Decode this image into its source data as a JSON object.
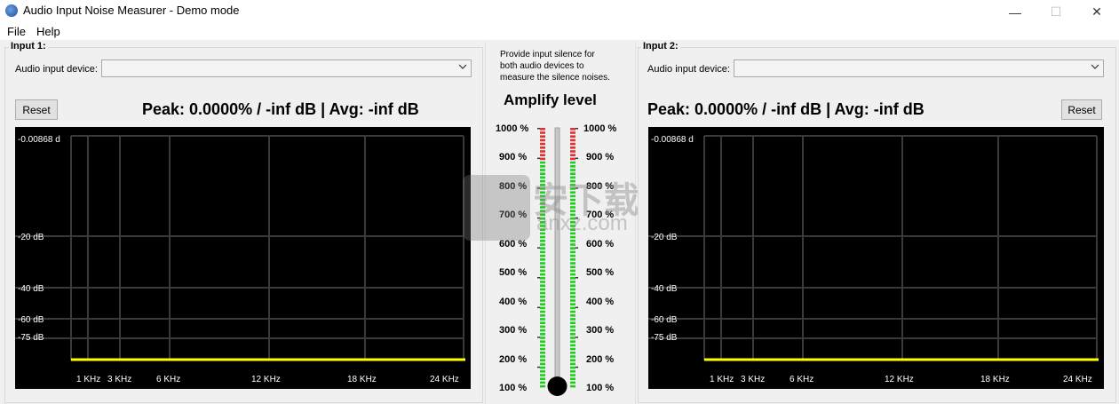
{
  "window": {
    "title": "Audio Input Noise Measurer - Demo mode",
    "min_glyph": "—",
    "max_glyph": "☐",
    "close_glyph": "✕"
  },
  "menu": {
    "items": [
      "File",
      "Help"
    ]
  },
  "input1": {
    "group_label": "Input 1:",
    "device_label": "Audio input device:",
    "device_value": "",
    "reset_label": "Reset",
    "peak_text": "Peak: 0.0000% / -inf dB | Avg: -inf dB"
  },
  "input2": {
    "group_label": "Input 2:",
    "device_label": "Audio input device:",
    "device_value": "",
    "reset_label": "Reset",
    "peak_text": "Peak: 0.0000% / -inf dB | Avg: -inf dB"
  },
  "spectrum": {
    "y_labels": [
      "-0.00868 d",
      "-20 dB",
      "-40 dB",
      "-60 dB",
      "-75 dB"
    ],
    "x_labels": [
      "1 KHz",
      "3 KHz",
      "6 KHz",
      "12 KHz",
      "18 KHz",
      "24 KHz"
    ],
    "line_color": "#ffff00",
    "grid_color": "#3a3a3a"
  },
  "amplify": {
    "hint": "Provide input silence for\nboth audio devices to\nmeasure the silence noises.",
    "title": "Amplify level",
    "scale_labels": [
      "1000 %",
      "900 %",
      "800 %",
      "700 %",
      "600 %",
      "500 %",
      "400 %",
      "300 %",
      "200 %",
      "100 %"
    ],
    "level_percent": 100,
    "meter_green": "#22cc22",
    "meter_red": "#dd3333"
  },
  "watermark": {
    "text1": "安下载",
    "text2": "anxz.com"
  }
}
